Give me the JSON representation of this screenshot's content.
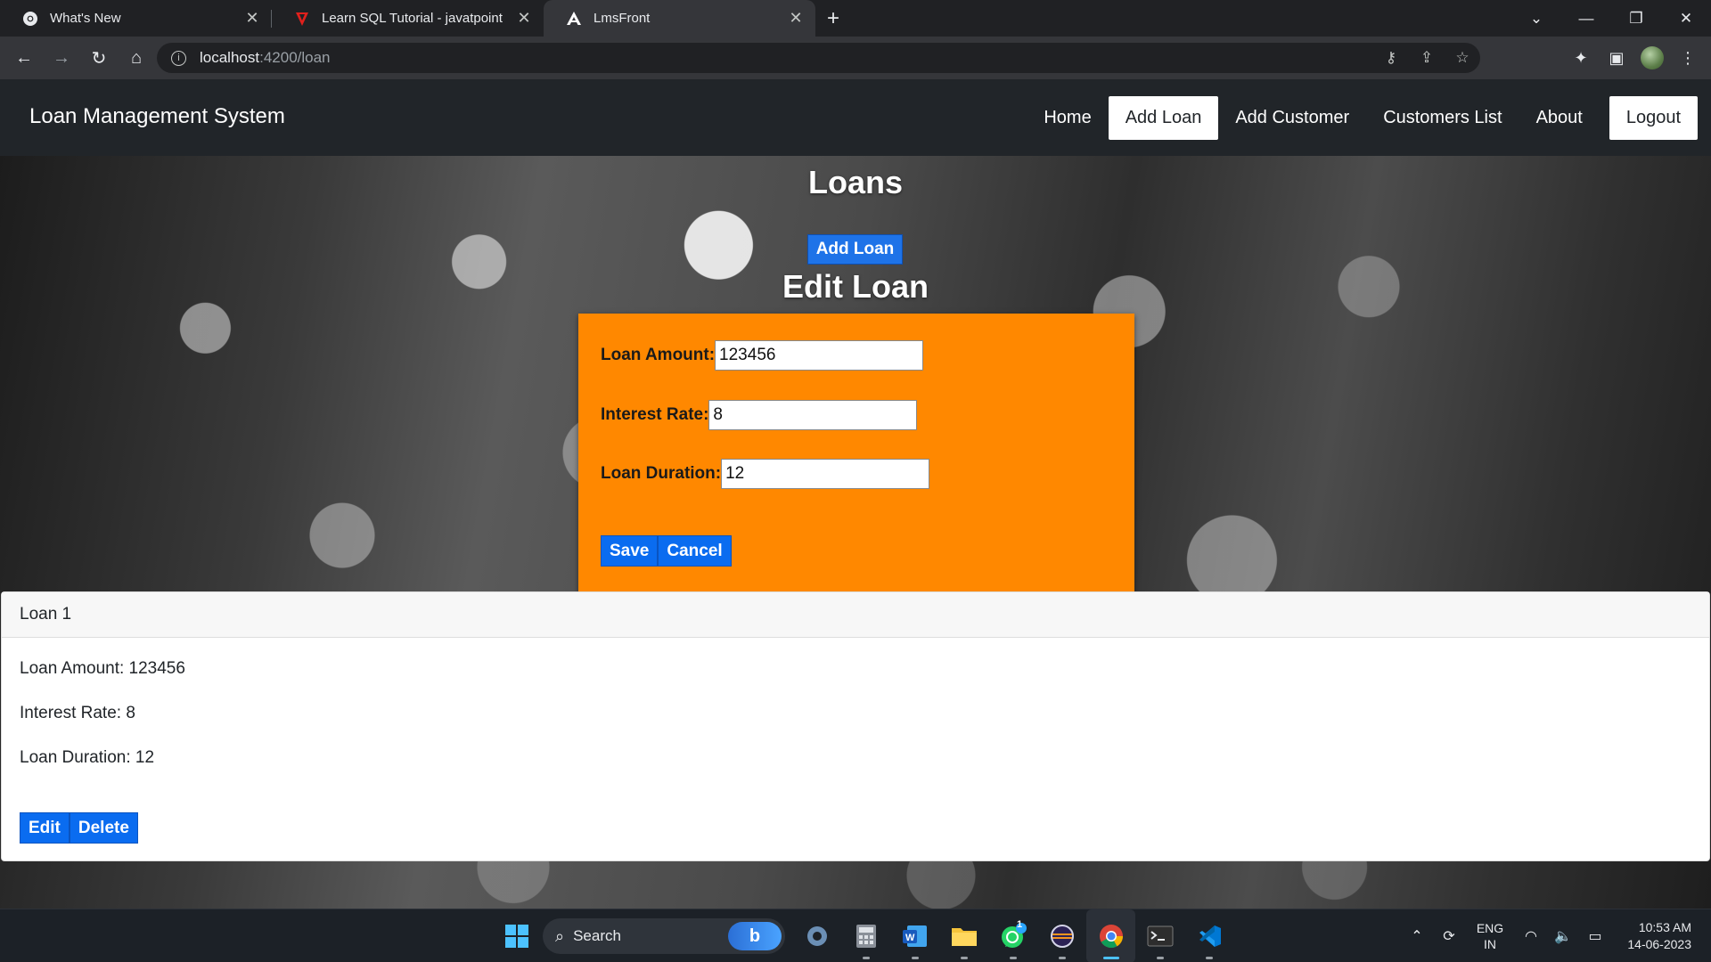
{
  "browser": {
    "tabs": [
      {
        "title": "What's New",
        "icon": "chrome-icon",
        "active": false
      },
      {
        "title": "Learn SQL Tutorial - javatpoint",
        "icon": "javatpoint-icon",
        "active": false
      },
      {
        "title": "LmsFront",
        "icon": "angular-icon",
        "active": true
      }
    ],
    "new_tab": "+",
    "url_host": "localhost",
    "url_path": ":4200/loan"
  },
  "navbar": {
    "brand": "Loan Management System",
    "links": [
      "Home",
      "Add Loan",
      "Add Customer",
      "Customers List",
      "About"
    ],
    "active_link": "Add Loan",
    "logout": "Logout"
  },
  "main": {
    "title": "Loans",
    "add_button": "Add Loan",
    "edit_title": "Edit Loan",
    "form": {
      "amount_label": "Loan Amount:",
      "amount_value": "123456",
      "rate_label": "Interest Rate:",
      "rate_value": "8",
      "duration_label": "Loan Duration:",
      "duration_value": "12",
      "save": "Save",
      "cancel": "Cancel"
    },
    "loan_card": {
      "header": "Loan 1",
      "amount": "Loan Amount: 123456",
      "rate": "Interest Rate: 8",
      "duration": "Loan Duration: 12",
      "edit": "Edit",
      "delete": "Delete"
    }
  },
  "taskbar": {
    "search": "Search",
    "whatsapp_badge": "1",
    "lang_top": "ENG",
    "lang_bottom": "IN",
    "time": "10:53 AM",
    "date": "14-06-2023"
  },
  "colors": {
    "form_bg": "#ff8800",
    "button_blue": "#0a6cf0",
    "navbar_bg": "#212529"
  }
}
